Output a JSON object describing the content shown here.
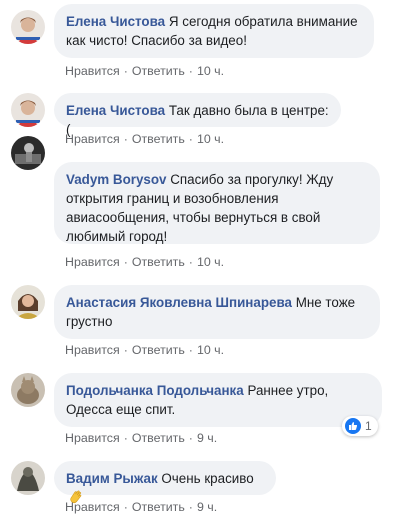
{
  "comments": [
    {
      "author": "Елена Чистова",
      "text_line1": "Я сегодня обратила внимание",
      "text_line2": "как чисто! Спасибо за видео!",
      "like": "Нравится",
      "reply": "Ответить",
      "time": "10 ч."
    },
    {
      "author": "Елена Чистова",
      "text_line1": "Так давно была в центре:(",
      "like": "Нравится",
      "reply": "Ответить",
      "time": "10 ч."
    },
    {
      "author": "Vadym Borysov",
      "text_line1": "Спасибо за прогулку! Жду",
      "text_line2": "открытия границ и возобновления",
      "text_line3": "авиасообщения, чтобы вернуться в свой",
      "text_line4": "любимый город!",
      "like": "Нравится",
      "reply": "Ответить",
      "time": "10 ч."
    },
    {
      "author": "Анастасия Яковлевна Шпинарева",
      "text_line1": "Мне тоже",
      "text_line2": "грустно",
      "like": "Нравится",
      "reply": "Ответить",
      "time": "10 ч."
    },
    {
      "author": "Подольчанка Подольчанка",
      "text_line1": "Раннее утро,",
      "text_line2": "Одесса еще спит.",
      "like": "Нравится",
      "reply": "Ответить",
      "time": "9 ч.",
      "reaction_count": "1",
      "reaction_icon": "like-icon"
    },
    {
      "author": "Вадим Рыжак",
      "text_line1": "Очень красиво",
      "emoji": "clapping-hands-icon",
      "like": "Нравится",
      "reply": "Ответить",
      "time": "9 ч."
    }
  ],
  "colors": {
    "author": "#385898",
    "bubble": "#f0f2f5",
    "meta": "#65676b",
    "like_badge": "#1877f2"
  }
}
